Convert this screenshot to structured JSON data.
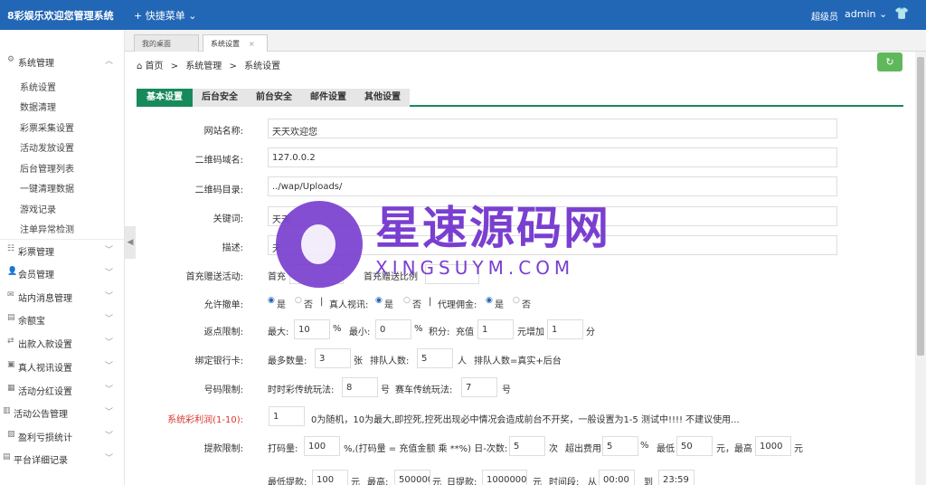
{
  "app": {
    "brand": "8彩娱乐欢迎您管理系统",
    "quick_menu": "+ 快捷菜单",
    "role": "超级员",
    "user": "admin"
  },
  "tabs": [
    {
      "label": "我的桌面"
    },
    {
      "label": "系统设置",
      "close": "×"
    }
  ],
  "breadcrumb": {
    "home": "首页",
    "sep1": ">",
    "level1": "系统管理",
    "sep2": ">",
    "current": "系统设置"
  },
  "sidebar": {
    "groups": [
      {
        "label": "系统管理"
      },
      {
        "label": "彩票管理"
      },
      {
        "label": "会员管理"
      },
      {
        "label": "站内消息管理"
      },
      {
        "label": "余额宝"
      },
      {
        "label": "出款入款设置"
      },
      {
        "label": "真人视讯设置"
      },
      {
        "label": "活动分红设置"
      },
      {
        "label": "活动公告管理"
      },
      {
        "label": "盈利亏损统计"
      },
      {
        "label": "平台详细记录"
      }
    ],
    "items": [
      {
        "label": "系统设置"
      },
      {
        "label": "数据清理"
      },
      {
        "label": "彩票采集设置"
      },
      {
        "label": "活动发放设置"
      },
      {
        "label": "后台管理列表"
      },
      {
        "label": "一键清理数据"
      },
      {
        "label": "游戏记录"
      },
      {
        "label": "注单异常检测"
      }
    ]
  },
  "form_tabs": [
    {
      "label": "基本设置"
    },
    {
      "label": "后台安全"
    },
    {
      "label": "前台安全"
    },
    {
      "label": "邮件设置"
    },
    {
      "label": "其他设置"
    }
  ],
  "form": {
    "site_name": {
      "label": "网站名称:",
      "value": "天天欢迎您"
    },
    "qr_domain": {
      "label": "二维码域名:",
      "value": "127.0.0.2"
    },
    "qr_dir": {
      "label": "二维码目录:",
      "value": "../wap/Uploads/"
    },
    "keywords": {
      "label": "关键词:",
      "value": "天天"
    },
    "description": {
      "label": "描述:",
      "value": "天"
    },
    "first_deposit": {
      "label": "首充赠送活动:",
      "a": "首充",
      "b": "首充赠送比例"
    },
    "allow_cancel": {
      "label": "允许撤单:",
      "yes": "是",
      "no": "否",
      "sep": "|",
      "live_label": "真人视讯:",
      "live_yes": "是",
      "live_no": "否",
      "sep2": "|",
      "agent_label": "代理佣金:",
      "agent_yes": "是",
      "agent_no": "否"
    },
    "rebate": {
      "label": "返点限制:",
      "max_label": "最大:",
      "max_value": "10",
      "pct1": "%",
      "min_label": "最小:",
      "min_value": "0",
      "pct2": "%",
      "points_label": "积分:",
      "recharge_label": "充值",
      "recharge_value": "1",
      "yuan_add": "元增加",
      "add_value": "1",
      "fen": "分"
    },
    "bind_bank": {
      "label": "绑定银行卡:",
      "max_label": "最多数量:",
      "max_value": "3",
      "zhang": "张",
      "queue_label": "排队人数:",
      "queue_value": "5",
      "ren": "人",
      "note": "排队人数=真实+后台"
    },
    "number_limit": {
      "label": "号码限制:",
      "ssc_label": "时时彩传统玩法:",
      "ssc_value": "8",
      "hao1": "号",
      "pk_label": "赛车传统玩法:",
      "pk_value": "7",
      "hao2": "号"
    },
    "system_kill": {
      "label": "系统彩利润(1-10):",
      "value": "1",
      "note": "0为随机，10为最大,即控死,控死出现必中情况会造成前台不开奖，一般设置为1-5 测试中!!!! 不建议使用..."
    },
    "withdraw_limit": {
      "label": "提款限制:",
      "bet_label": "打码量:",
      "bet_value": "100",
      "formula": "%,(打码量 = 充值金额 乘 **%) 日-次数:",
      "times_value": "5",
      "ci": "次",
      "fee_label": "超出费用",
      "fee_value": "5",
      "pct": "%",
      "min_fee_label": "最低",
      "min_fee_value": "50",
      "yuan_max": "元，最高",
      "max_fee_value": "1000",
      "yuan": "元"
    },
    "withdraw_range": {
      "min_label": "最低提款:",
      "min_value": "100",
      "yuan1": "元",
      "max_label": "最高:",
      "max_value": "500000",
      "yuan2": "元",
      "day_label": "日提款:",
      "day_value": "1000000",
      "yuan3": "元",
      "time_label": "时间段:",
      "from_label": "从",
      "from_value": "00:00",
      "to_label": "到",
      "to_value": "23:59"
    }
  },
  "watermark": {
    "title": "星速源码网",
    "subtitle": "XINGSUYM.COM"
  }
}
